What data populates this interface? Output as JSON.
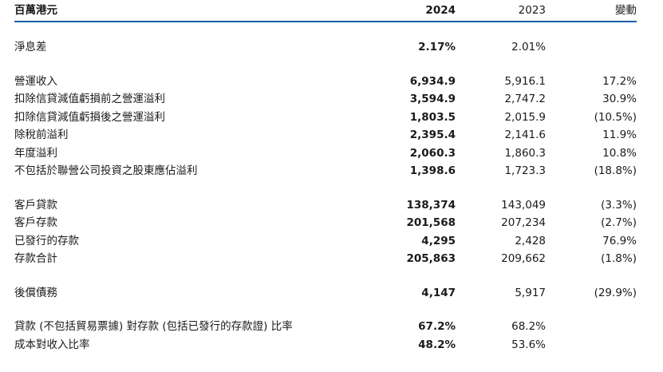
{
  "header": {
    "unit_label": "百萬港元",
    "col_2024": "2024",
    "col_2023": "2023",
    "col_change": "變動"
  },
  "groups": [
    {
      "rows": [
        {
          "label": "淨息差",
          "v2024": "2.17%",
          "v2023": "2.01%",
          "change": ""
        }
      ]
    },
    {
      "rows": [
        {
          "label": "營運收入",
          "v2024": "6,934.9",
          "v2023": "5,916.1",
          "change": "17.2%"
        },
        {
          "label": "扣除信貸減值虧損前之營運溢利",
          "v2024": "3,594.9",
          "v2023": "2,747.2",
          "change": "30.9%"
        },
        {
          "label": "扣除信貸減值虧損後之營運溢利",
          "v2024": "1,803.5",
          "v2023": "2,015.9",
          "change": "(10.5%)"
        },
        {
          "label": "除稅前溢利",
          "v2024": "2,395.4",
          "v2023": "2,141.6",
          "change": "11.9%"
        },
        {
          "label": "年度溢利",
          "v2024": "2,060.3",
          "v2023": "1,860.3",
          "change": "10.8%"
        },
        {
          "label": "不包括於聯營公司投資之股東應佔溢利",
          "v2024": "1,398.6",
          "v2023": "1,723.3",
          "change": "(18.8%)"
        }
      ]
    },
    {
      "rows": [
        {
          "label": "客戶貸款",
          "v2024": "138,374",
          "v2023": "143,049",
          "change": "(3.3%)"
        },
        {
          "label": "客戶存款",
          "v2024": "201,568",
          "v2023": "207,234",
          "change": "(2.7%)"
        },
        {
          "label": "已發行的存款",
          "v2024": "4,295",
          "v2023": "2,428",
          "change": "76.9%"
        },
        {
          "label": "存款合計",
          "v2024": "205,863",
          "v2023": "209,662",
          "change": "(1.8%)"
        }
      ]
    },
    {
      "rows": [
        {
          "label": "後償債務",
          "v2024": "4,147",
          "v2023": "5,917",
          "change": "(29.9%)"
        }
      ]
    },
    {
      "rows": [
        {
          "label": "貸款 (不包括貿易票據) 對存款 (包括已發行的存款證) 比率",
          "v2024": "67.2%",
          "v2023": "68.2%",
          "change": ""
        },
        {
          "label": "成本對收入比率",
          "v2024": "48.2%",
          "v2023": "53.6%",
          "change": ""
        }
      ]
    }
  ],
  "colors": {
    "header_rule": "#1f5fa8",
    "text": "#1a1a1a"
  }
}
